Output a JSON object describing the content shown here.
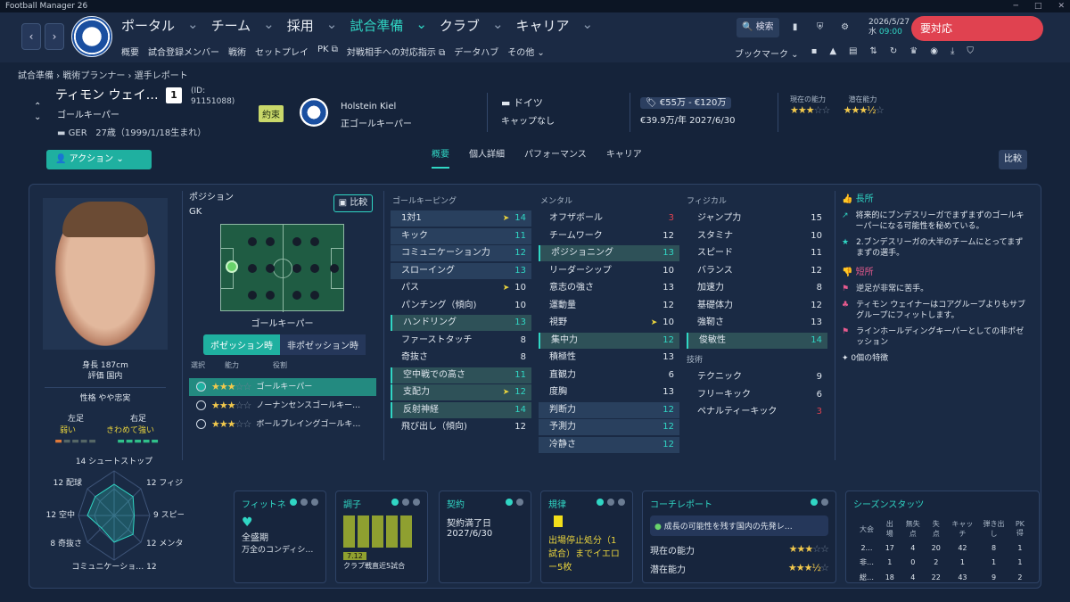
{
  "window": {
    "title": "Football Manager 26"
  },
  "nav": {
    "items": [
      "ポータル",
      "チーム",
      "採用",
      "試合準備",
      "クラブ",
      "キャリア"
    ],
    "active": "試合準備",
    "sub": [
      "概要",
      "試合登録メンバー",
      "戦術",
      "セットプレイ",
      "PK",
      "対戦相手への対応指示",
      "データハブ",
      "その他"
    ]
  },
  "top": {
    "search": "検索",
    "date": "2026/5/27",
    "day": "水",
    "time": "09:00",
    "due": "要対応",
    "bookmark": "ブックマーク"
  },
  "breadcrumb": [
    "試合準備",
    "戦術プランナー",
    "選手レポート"
  ],
  "player": {
    "name": "ティモン ウェイ…",
    "number": "1",
    "id_label": "(ID:",
    "id": "91151088)",
    "position": "ゴールキーパー",
    "nation_code": "GER",
    "age": "27歳（1999/1/18生まれ）",
    "promise": "約束",
    "club": "Holstein Kiel",
    "club_role": "正ゴールキーパー",
    "nationality": "ドイツ",
    "caps": "キャップなし",
    "value": "€55万 - €120万",
    "wage": "€39.9万/年 2027/6/30",
    "current_ability_label": "現在の能力",
    "potential_ability_label": "潜在能力",
    "current_ability_stars": 3,
    "potential_ability_stars": 3.5
  },
  "action": "アクション",
  "tabs": [
    "概要",
    "個人詳細",
    "パフォーマンス",
    "キャリア"
  ],
  "compare": "比較",
  "profile": {
    "height": "身長 187cm",
    "reputation": "評価 国内",
    "personality": "性格 やや忠実",
    "left_foot_label": "左足",
    "right_foot_label": "右足",
    "left_foot": "弱い",
    "right_foot": "きわめて強い"
  },
  "radar": {
    "labels": [
      "シュートストップ",
      "フィジカル",
      "スピード",
      "メンタル",
      "コミュニケーション力",
      "奇抜さ",
      "空中",
      "配球"
    ],
    "values": [
      14,
      12,
      9,
      12,
      12,
      8,
      12,
      12
    ]
  },
  "position_panel": {
    "title": "ポジション",
    "pos": "GK",
    "compare": "比較",
    "caption": "ゴールキーパー",
    "phase_on": "ポゼッション時",
    "phase_off": "非ポゼッション時",
    "headers": [
      "選択",
      "能力",
      "役割"
    ],
    "roles": [
      {
        "name": "ゴールキーパー",
        "stars": 3
      },
      {
        "name": "ノーナンセンスゴールキー…",
        "stars": 3
      },
      {
        "name": "ボールプレイングゴールキ…",
        "stars": 3
      }
    ]
  },
  "goalkeeping": {
    "title": "ゴールキーピング",
    "attrs": [
      {
        "n": "1対1",
        "v": 14,
        "s": "bl",
        "a": true
      },
      {
        "n": "キック",
        "v": 11,
        "s": "bl"
      },
      {
        "n": "コミュニケーション力",
        "v": 12,
        "s": "bl"
      },
      {
        "n": "スローイング",
        "v": 13,
        "s": "bl"
      },
      {
        "n": "パス",
        "v": 10,
        "s": "",
        "a": true
      },
      {
        "n": "パンチング（傾向)",
        "v": 10,
        "s": ""
      },
      {
        "n": "ハンドリング",
        "v": 13,
        "s": "hl"
      },
      {
        "n": "ファーストタッチ",
        "v": 8,
        "s": ""
      },
      {
        "n": "奇抜さ",
        "v": 8,
        "s": ""
      },
      {
        "n": "空中戦での高さ",
        "v": 11,
        "s": "hl"
      },
      {
        "n": "支配力",
        "v": 12,
        "s": "hl",
        "a": true
      },
      {
        "n": "反射神経",
        "v": 14,
        "s": "hl"
      },
      {
        "n": "飛び出し（傾向)",
        "v": 12,
        "s": ""
      }
    ]
  },
  "mental": {
    "title": "メンタル",
    "attrs": [
      {
        "n": "オフザボール",
        "v": 3,
        "s": "",
        "r": true
      },
      {
        "n": "チームワーク",
        "v": 12,
        "s": ""
      },
      {
        "n": "ポジショニング",
        "v": 13,
        "s": "hl"
      },
      {
        "n": "リーダーシップ",
        "v": 10,
        "s": ""
      },
      {
        "n": "意志の強さ",
        "v": 13,
        "s": ""
      },
      {
        "n": "運動量",
        "v": 12,
        "s": ""
      },
      {
        "n": "視野",
        "v": 10,
        "s": "",
        "a": true
      },
      {
        "n": "集中力",
        "v": 12,
        "s": "hl"
      },
      {
        "n": "積極性",
        "v": 13,
        "s": ""
      },
      {
        "n": "直観力",
        "v": 6,
        "s": ""
      },
      {
        "n": "度胸",
        "v": 13,
        "s": ""
      },
      {
        "n": "判断力",
        "v": 12,
        "s": "bl"
      },
      {
        "n": "予測力",
        "v": 12,
        "s": "bl"
      },
      {
        "n": "冷静さ",
        "v": 12,
        "s": "bl"
      }
    ]
  },
  "physical": {
    "title": "フィジカル",
    "attrs": [
      {
        "n": "ジャンプ力",
        "v": 15,
        "s": ""
      },
      {
        "n": "スタミナ",
        "v": 10,
        "s": ""
      },
      {
        "n": "スピード",
        "v": 11,
        "s": ""
      },
      {
        "n": "バランス",
        "v": 12,
        "s": ""
      },
      {
        "n": "加速力",
        "v": 8,
        "s": ""
      },
      {
        "n": "基礎体力",
        "v": 12,
        "s": ""
      },
      {
        "n": "強靭さ",
        "v": 13,
        "s": ""
      },
      {
        "n": "俊敏性",
        "v": 14,
        "s": "hl"
      }
    ]
  },
  "technical": {
    "title": "技術",
    "attrs": [
      {
        "n": "テクニック",
        "v": 9,
        "s": ""
      },
      {
        "n": "フリーキック",
        "v": 6,
        "s": ""
      },
      {
        "n": "ペナルティーキック",
        "v": 3,
        "s": "",
        "r": true
      }
    ]
  },
  "strengths": {
    "title": "長所",
    "items": [
      "将来的にブンデスリーガでまずまずのゴールキーパーになる可能性を秘めている。",
      "2.ブンデスリーガの大半のチームにとってまずまずの選手。"
    ],
    "weak_title": "短所",
    "weak": [
      "逆足が非常に苦手。",
      "ティモン ウェイナーはコアグループよりもサブグループにフィットします。",
      "ラインホールディングキーパーとしての非ポゼッション"
    ],
    "traits": "0個の特徴"
  },
  "cards": {
    "fitness": {
      "title": "フィットネ",
      "state": "全盛期",
      "sub": "万全のコンディシ…"
    },
    "form": {
      "title": "調子",
      "avg": "7.12",
      "caption": "クラブ戦直近5試合",
      "bars": [
        0.6,
        0.6,
        0.6,
        0.6,
        0.6
      ]
    },
    "contract": {
      "title": "契約",
      "label": "契約満了日",
      "date": "2027/6/30"
    },
    "discipline": {
      "title": "規律",
      "text": "出場停止処分（1試合）までイエロー5枚"
    },
    "coach": {
      "title": "コーチレポート",
      "line": "成長の可能性を残す国内の先発レ…",
      "cur": "現在の能力",
      "pot": "潜在能力"
    },
    "season": {
      "title": "シーズンスタッツ",
      "headers": [
        "大会",
        "出場",
        "無失点",
        "失点",
        "キャッチ",
        "弾き出し",
        "PK得"
      ],
      "rows": [
        [
          "2…",
          "17",
          "4",
          "20",
          "42",
          "8",
          "1"
        ],
        [
          "非…",
          "1",
          "0",
          "2",
          "1",
          "1",
          "1"
        ],
        [
          "総…",
          "18",
          "4",
          "22",
          "43",
          "9",
          "2"
        ]
      ]
    }
  }
}
